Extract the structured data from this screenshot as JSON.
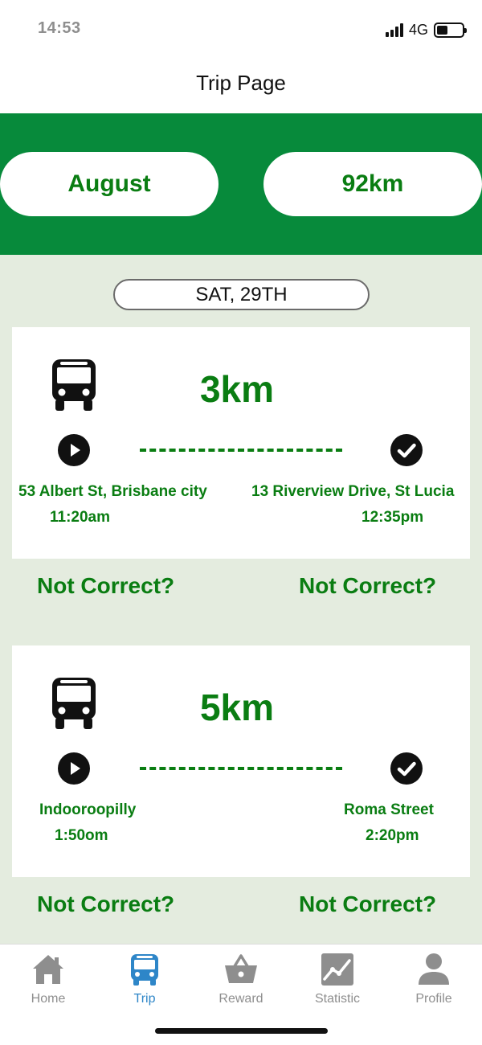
{
  "status_bar": {
    "time": "14:53",
    "network": "4G",
    "battery_level": 0.5
  },
  "header": {
    "title": "Trip Page"
  },
  "summary": {
    "month": "August",
    "total_distance": "92km",
    "accent_color": "#078a3b"
  },
  "date_label": "SAT, 29TH",
  "trips": [
    {
      "mode_icon": "bus-icon",
      "distance": "3km",
      "start_place": "53 Albert St, Brisbane city",
      "start_time": "11:20am",
      "end_place": "13 Riverview Drive, St Lucia",
      "end_time": "12:35pm",
      "start_correction_label": "Not Correct?",
      "end_correction_label": "Not Correct?"
    },
    {
      "mode_icon": "bus-icon",
      "distance": "5km",
      "start_place": "Indooroopilly",
      "start_time": "1:50om",
      "end_place": "Roma Street",
      "end_time": "2:20pm",
      "start_correction_label": "Not Correct?",
      "end_correction_label": "Not Correct?"
    }
  ],
  "tab_bar": {
    "active_tab": "Trip",
    "active_color": "#2e86c8",
    "tabs": [
      {
        "label": "Home",
        "icon": "home-icon"
      },
      {
        "label": "Trip",
        "icon": "bus-icon"
      },
      {
        "label": "Reward",
        "icon": "basket-icon"
      },
      {
        "label": "Statistic",
        "icon": "chart-icon"
      },
      {
        "label": "Profile",
        "icon": "person-icon"
      }
    ]
  }
}
